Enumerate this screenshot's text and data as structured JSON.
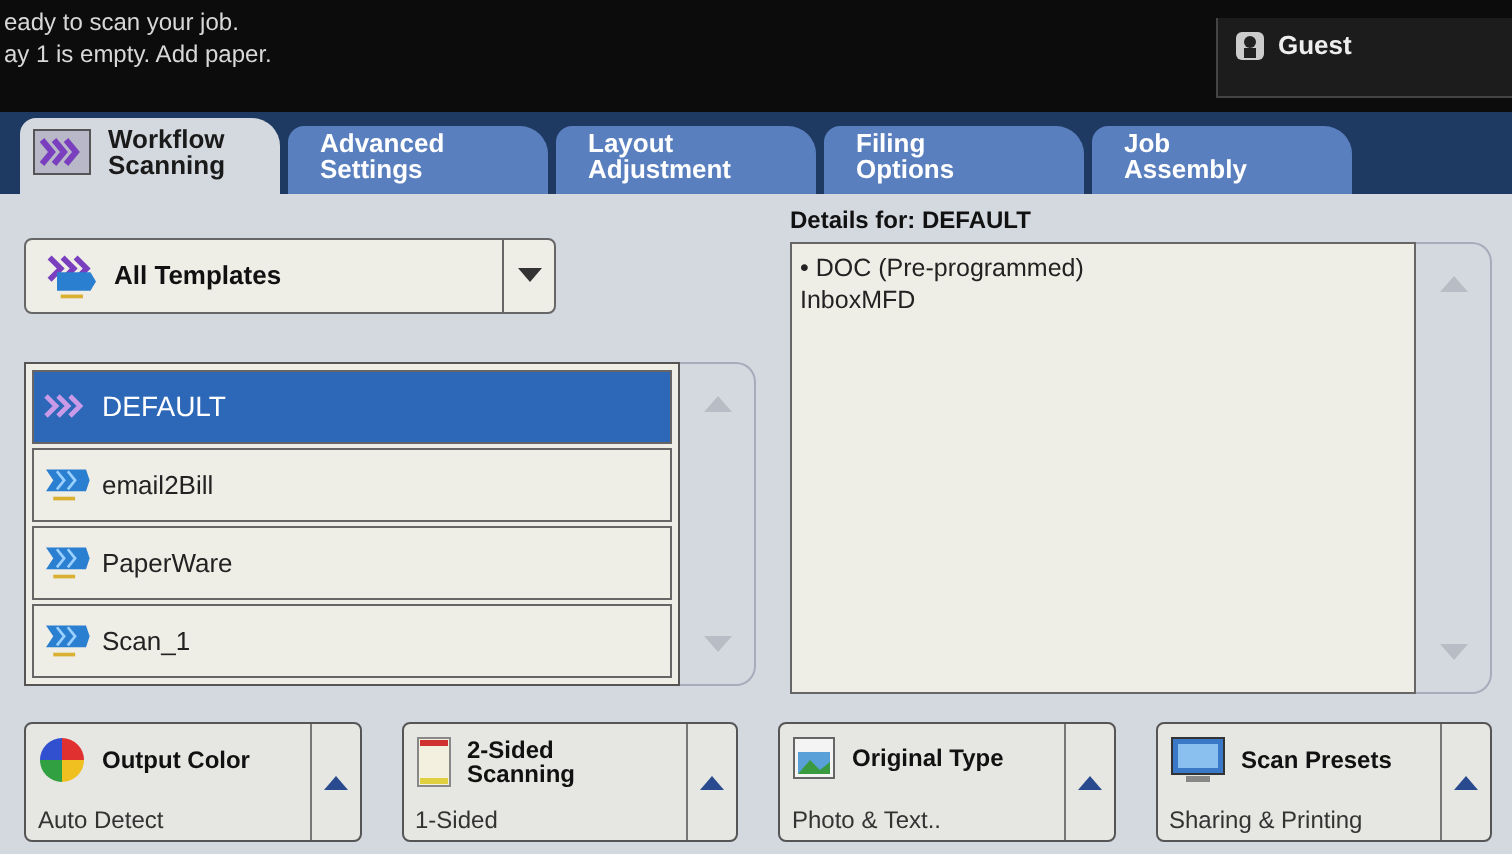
{
  "status_messages": [
    "eady to scan your job.",
    "ay 1 is empty.  Add paper."
  ],
  "user": {
    "label": "Guest"
  },
  "tabs": [
    {
      "lines": [
        "Workflow",
        "Scanning"
      ],
      "selected": true
    },
    {
      "lines": [
        "Advanced",
        "Settings"
      ],
      "selected": false
    },
    {
      "lines": [
        "Layout",
        "Adjustment"
      ],
      "selected": false
    },
    {
      "lines": [
        "Filing",
        "Options"
      ],
      "selected": false
    },
    {
      "lines": [
        "Job",
        "Assembly"
      ],
      "selected": false
    }
  ],
  "template_filter": {
    "value": "All Templates"
  },
  "templates": [
    {
      "name": "DEFAULT",
      "selected": true
    },
    {
      "name": "email2Bill",
      "selected": false
    },
    {
      "name": "PaperWare",
      "selected": false
    },
    {
      "name": "Scan_1",
      "selected": false
    }
  ],
  "details": {
    "heading": "Details for: DEFAULT",
    "lines": [
      "• DOC (Pre-programmed)",
      "InboxMFD"
    ]
  },
  "feature_buttons": [
    {
      "kind": "color",
      "title_lines": [
        "Output Color"
      ],
      "value": "Auto Detect"
    },
    {
      "kind": "sides",
      "title_lines": [
        "2-Sided",
        "Scanning"
      ],
      "value": "1-Sided"
    },
    {
      "kind": "original",
      "title_lines": [
        "Original Type"
      ],
      "value": "Photo & Text.."
    },
    {
      "kind": "presets",
      "title_lines": [
        "Scan Presets"
      ],
      "value": "Sharing & Printing"
    }
  ]
}
